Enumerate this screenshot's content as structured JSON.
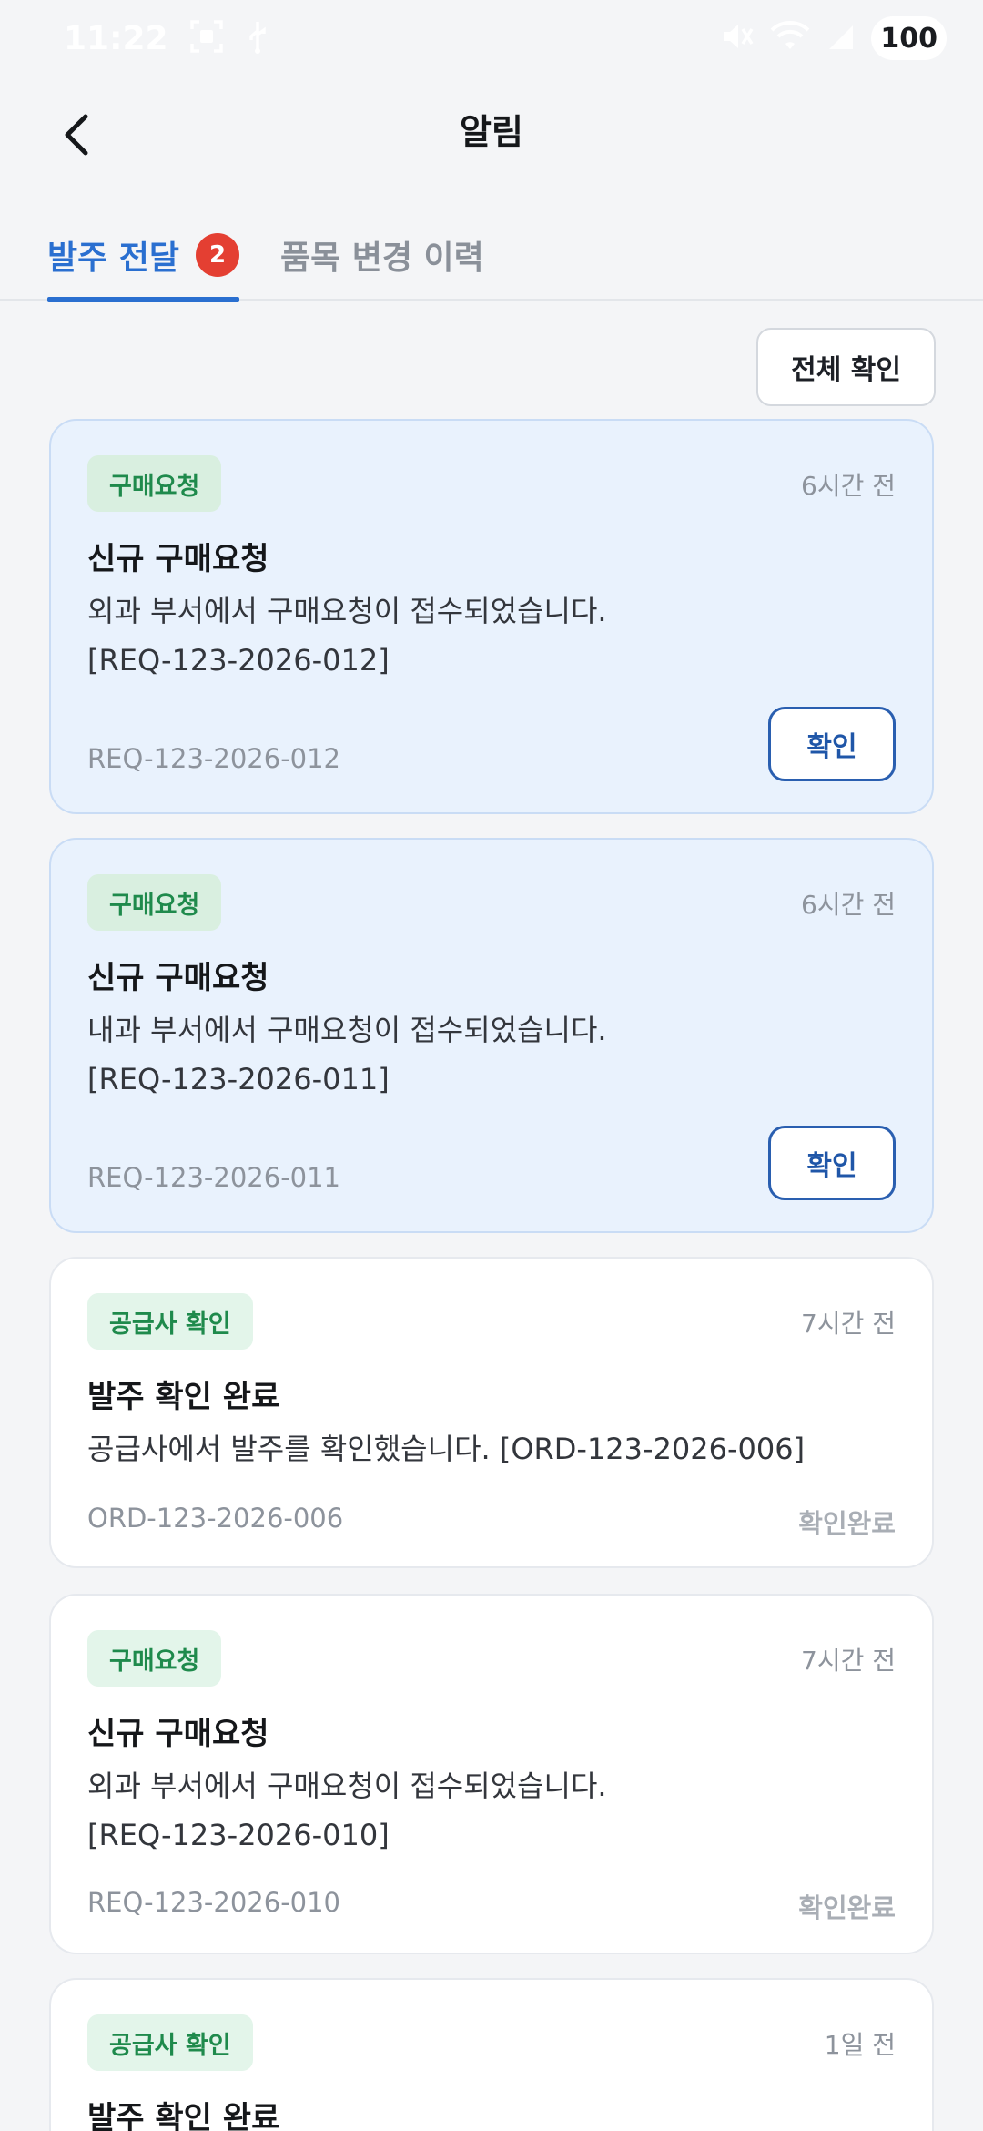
{
  "status_bar": {
    "time": "11:22",
    "battery": "100",
    "icons": [
      "screenshot-icon",
      "usb-icon",
      "mute-icon",
      "wifi-icon",
      "signal-icon"
    ]
  },
  "header": {
    "title": "알림",
    "back_icon": "chevron-left-icon"
  },
  "tabs": [
    {
      "label": "발주 전달",
      "badge": "2",
      "active": true
    },
    {
      "label": "품목 변경 이력",
      "active": false
    }
  ],
  "confirm_all_label": "전체 확인",
  "colors": {
    "accent": "#2a6fd0",
    "badge": "#e43f32",
    "tag_text": "#1f8a4c",
    "tag_bg": "#e3f5ea",
    "unread_card_bg": "#e9f2fd"
  },
  "notifications": [
    {
      "tag": "구매요청",
      "time": "6시간 전",
      "title": "신규 구매요청",
      "body_lines": [
        "외과 부서에서 구매요청이 접수되었습니다.",
        "[REQ-123-2026-012]"
      ],
      "ref": "REQ-123-2026-012",
      "action": "확인",
      "unread": true
    },
    {
      "tag": "구매요청",
      "time": "6시간 전",
      "title": "신규 구매요청",
      "body_lines": [
        "내과 부서에서 구매요청이 접수되었습니다.",
        "[REQ-123-2026-011]"
      ],
      "ref": "REQ-123-2026-011",
      "action": "확인",
      "unread": true
    },
    {
      "tag": "공급사 확인",
      "time": "7시간 전",
      "title": "발주 확인 완료",
      "body_lines": [
        "공급사에서 발주를 확인했습니다. [ORD-123-2026-006]"
      ],
      "ref": "ORD-123-2026-006",
      "status": "확인완료",
      "unread": false
    },
    {
      "tag": "구매요청",
      "time": "7시간 전",
      "title": "신규 구매요청",
      "body_lines": [
        "외과 부서에서 구매요청이 접수되었습니다.",
        "[REQ-123-2026-010]"
      ],
      "ref": "REQ-123-2026-010",
      "status": "확인완료",
      "unread": false
    },
    {
      "tag": "공급사 확인",
      "time": "1일 전",
      "title": "발주 확인 완료",
      "unread": false
    }
  ]
}
